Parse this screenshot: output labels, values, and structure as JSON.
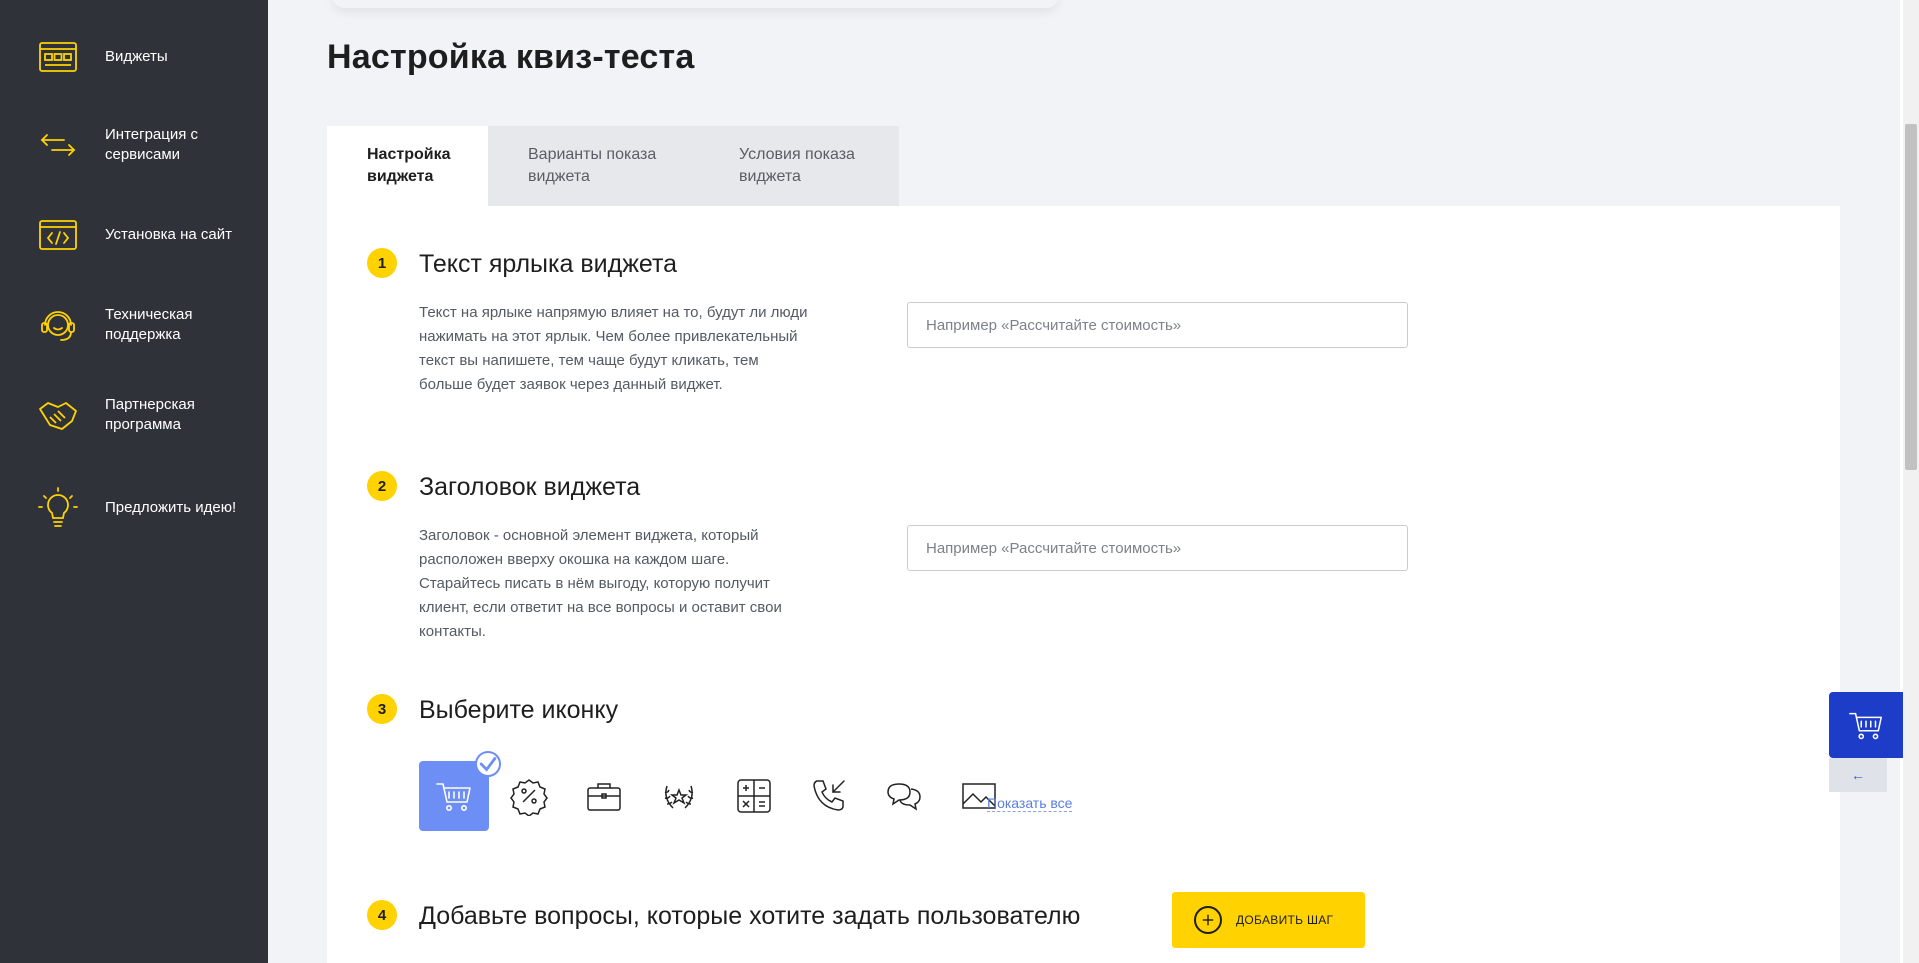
{
  "sidebar": {
    "items": [
      {
        "label": "Виджеты",
        "icon": "widgets-icon"
      },
      {
        "label": "Интеграция с сервисами",
        "icon": "integration-arrows-icon"
      },
      {
        "label": "Установка на сайт",
        "icon": "code-icon"
      },
      {
        "label": "Техническая поддержка",
        "icon": "support-headset-icon"
      },
      {
        "label": "Партнерская программа",
        "icon": "handshake-icon"
      },
      {
        "label": "Предложить идею!",
        "icon": "lightbulb-icon"
      }
    ],
    "accent_color": "#ffd200"
  },
  "page": {
    "title": "Настройка квиз-теста"
  },
  "tabs": [
    {
      "label": "Настройка виджета",
      "active": true
    },
    {
      "label": "Варианты показа виджета",
      "active": false
    },
    {
      "label": "Условия показа виджета",
      "active": false
    }
  ],
  "steps": [
    {
      "number": "1",
      "title": "Текст ярлыка виджета",
      "description": "Текст на ярлыке напрямую влияет на то, будут ли люди нажимать на этот ярлык. Чем более привлекательный текст вы напишете, тем чаще будут кликать, тем больше будет заявок через данный виджет.",
      "placeholder": "Например «Рассчитайте стоимость»"
    },
    {
      "number": "2",
      "title": "Заголовок виджета",
      "description": "Заголовок - основной элемент виджета, который расположен вверху окошка на каждом шаге. Старайтесь писать в нём выгоду, которую получит клиент, если ответит на все вопросы и оставит свои контакты.",
      "placeholder": "Например «Рассчитайте стоимость»"
    },
    {
      "number": "3",
      "title": "Выберите иконку",
      "icons": [
        "cart-icon",
        "percent-badge-icon",
        "briefcase-icon",
        "laurel-star-icon",
        "calculator-icon",
        "phone-incoming-icon",
        "chat-bubbles-icon",
        "image-icon"
      ],
      "selected_icon": "cart-icon",
      "show_all_label": "Показать все"
    },
    {
      "number": "4",
      "title": "Добавьте вопросы, которые хотите задать пользователю",
      "add_button_label": "ДОБАВИТЬ ШАГ"
    }
  ],
  "float_widget": {
    "icon": "cart-icon",
    "collapse_label": "←",
    "color": "#1d3dc9"
  }
}
